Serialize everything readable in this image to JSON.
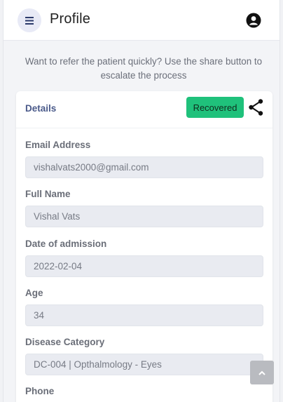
{
  "header": {
    "title": "Profile",
    "menu_icon": "hamburger-icon",
    "avatar_icon": "user-circle-icon"
  },
  "hint": {
    "text": "Want to refer the patient quickly? Use the share button to escalate the process"
  },
  "card": {
    "title": "Details",
    "status": "Recovered",
    "share_icon": "share-icon",
    "fields": [
      {
        "label": "Email Address",
        "value": "vishalvats2000@gmail.com"
      },
      {
        "label": "Full Name",
        "value": "Vishal Vats"
      },
      {
        "label": "Date of admission",
        "value": "2022-02-04"
      },
      {
        "label": "Age",
        "value": "34"
      },
      {
        "label": "Disease Category",
        "value": "DC-004 | Opthalmology - Eyes"
      },
      {
        "label": "Phone",
        "value": ""
      }
    ]
  },
  "scroll_top_icon": "chevron-up-icon",
  "colors": {
    "status_badge": "#1fc17b",
    "card_title": "#4a5a8a",
    "menu_button_bg": "#e8eaf6"
  }
}
